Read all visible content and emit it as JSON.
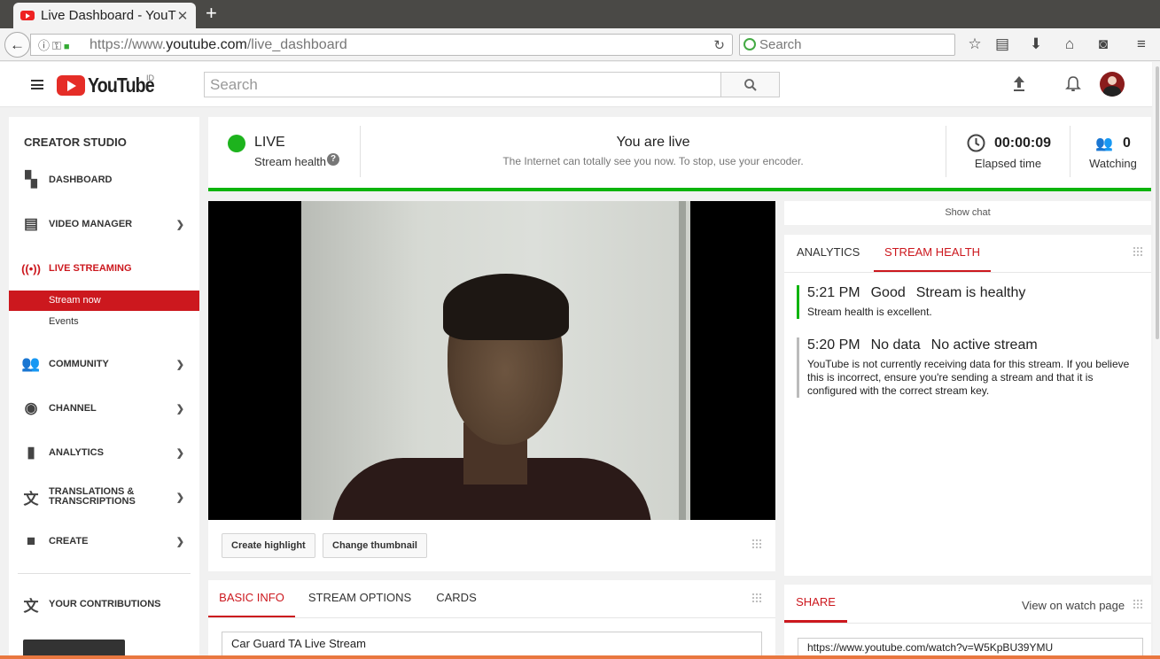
{
  "browser": {
    "tab_title": "Live Dashboard - YouTube",
    "tab_close": "✕",
    "new_tab": "+",
    "url_prefix": "https://www.",
    "url_domain": "youtube.com",
    "url_path": "/live_dashboard",
    "search_placeholder": "Search"
  },
  "header": {
    "logo_text": "YouTube",
    "region": "ID",
    "search_placeholder": "Search"
  },
  "sidebar": {
    "title": "CREATOR STUDIO",
    "items": [
      {
        "label": "DASHBOARD",
        "icon": "dashboard-icon"
      },
      {
        "label": "VIDEO MANAGER",
        "icon": "video-manager-icon"
      },
      {
        "label": "LIVE STREAMING",
        "icon": "live-icon"
      },
      {
        "label": "COMMUNITY",
        "icon": "community-icon"
      },
      {
        "label": "CHANNEL",
        "icon": "channel-icon"
      },
      {
        "label": "ANALYTICS",
        "icon": "analytics-icon"
      },
      {
        "label": "TRANSLATIONS & TRANSCRIPTIONS",
        "icon": "translate-icon"
      },
      {
        "label": "CREATE",
        "icon": "create-icon"
      },
      {
        "label": "YOUR CONTRIBUTIONS",
        "icon": "contributions-icon"
      }
    ],
    "sub_items": [
      {
        "label": "Stream now",
        "active": true
      },
      {
        "label": "Events",
        "active": false
      }
    ]
  },
  "status": {
    "live_label": "LIVE",
    "stream_health_label": "Stream health",
    "headline": "You are live",
    "subline": "The Internet can totally see you now. To stop, use your encoder.",
    "elapsed_value": "00:00:09",
    "elapsed_label": "Elapsed time",
    "watching_value": "0",
    "watching_label": "Watching",
    "live_color": "#1db31d"
  },
  "video_actions": {
    "create_highlight": "Create highlight",
    "change_thumbnail": "Change thumbnail"
  },
  "show_chat": "Show chat",
  "health_panel": {
    "tabs": [
      "ANALYTICS",
      "STREAM HEALTH"
    ],
    "entries": [
      {
        "time": "5:21 PM",
        "status": "Good",
        "summary": "Stream is healthy",
        "detail": "Stream health is excellent."
      },
      {
        "time": "5:20 PM",
        "status": "No data",
        "summary": "No active stream",
        "detail": "YouTube is not currently receiving data for this stream. If you believe this is incorrect, ensure you're sending a stream and that it is configured with the correct stream key."
      }
    ]
  },
  "info_panel": {
    "tabs": [
      "BASIC INFO",
      "STREAM OPTIONS",
      "CARDS"
    ],
    "title_value": "Car Guard TA Live Stream"
  },
  "share_panel": {
    "tab": "SHARE",
    "view_link": "View on watch page",
    "share_url": "https://www.youtube.com/watch?v=W5KpBU39YMU"
  },
  "colors": {
    "accent": "#cc181e",
    "green": "#0cb40c"
  }
}
